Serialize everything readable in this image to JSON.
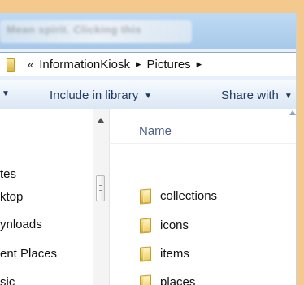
{
  "window": {
    "title_blurred": "Mean spirit. Clicking this"
  },
  "address": {
    "overflow_glyph": "«",
    "crumbs": [
      "InformationKiosk",
      "Pictures"
    ],
    "separator": "▸"
  },
  "toolbar": {
    "items": [
      {
        "label": "Include in library"
      },
      {
        "label": "Share with"
      }
    ],
    "arrow": "▼"
  },
  "navigation": {
    "items": [
      "tes",
      "ktop",
      "ynloads",
      "ent Places",
      "sic"
    ]
  },
  "list": {
    "header": "Name",
    "folders": [
      "collections",
      "icons",
      "items",
      "places"
    ]
  },
  "colors": {
    "background_frame": "#f4c98d",
    "title_blue": "#afcff0",
    "toolbar_text": "#1f3b63"
  }
}
